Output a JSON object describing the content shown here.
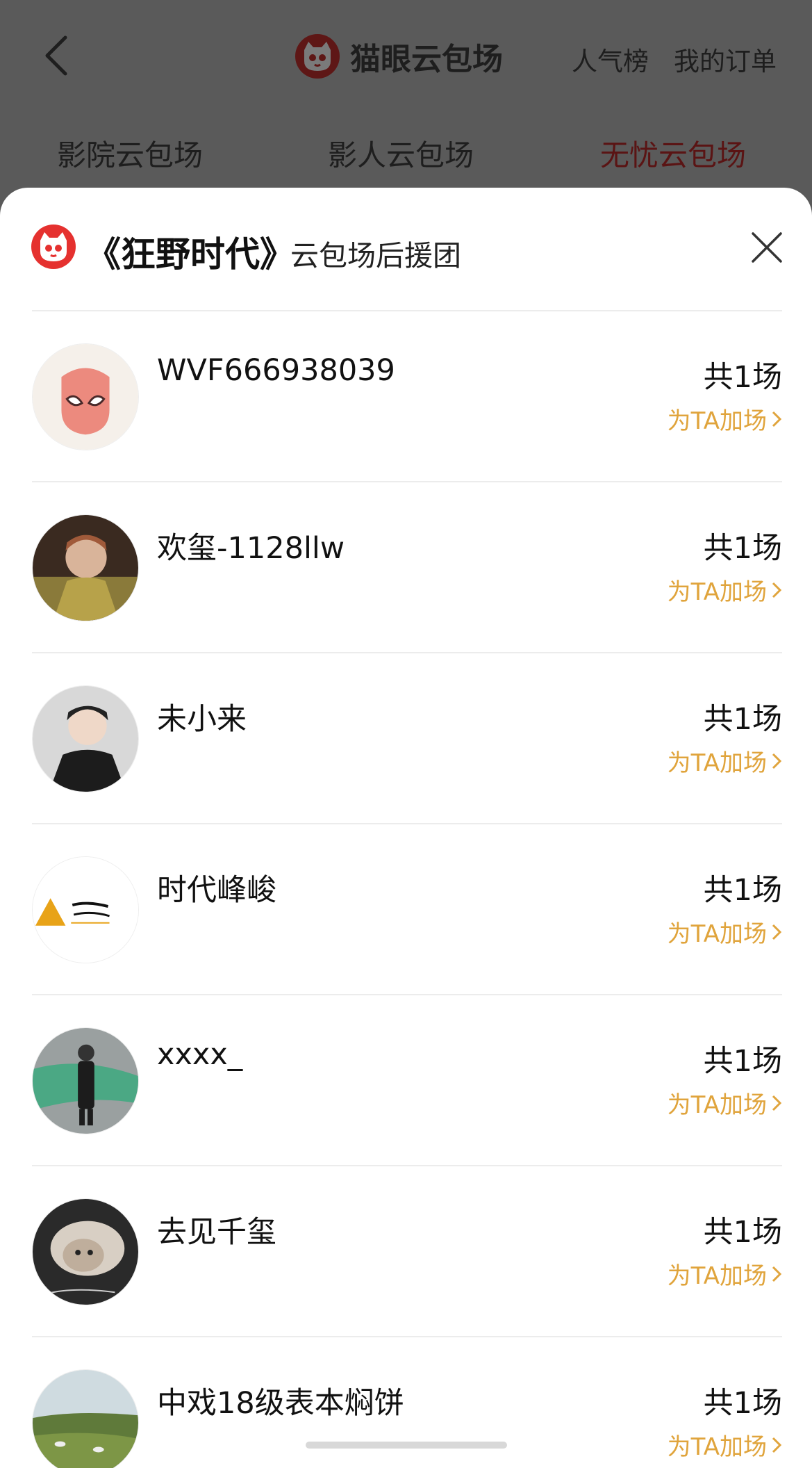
{
  "top_bar": {
    "back_icon": "chevron-left-icon",
    "brand_title": "猫眼云包场",
    "links": [
      "人气榜",
      "我的订单"
    ]
  },
  "tabs": [
    {
      "label": "影院云包场"
    },
    {
      "label": "影人云包场"
    },
    {
      "label": "无忧云包场"
    }
  ],
  "sheet": {
    "title": "《狂野时代》",
    "subtitle": "云包场后援团",
    "close_icon": "close-icon"
  },
  "supporters": [
    {
      "name": "WVF666938039",
      "count": "共1场",
      "action": "为TA加场"
    },
    {
      "name": "欢玺-1128llw",
      "count": "共1场",
      "action": "为TA加场"
    },
    {
      "name": "未小来",
      "count": "共1场",
      "action": "为TA加场"
    },
    {
      "name": "时代峰峻",
      "count": "共1场",
      "action": "为TA加场"
    },
    {
      "name": "xxxx_",
      "count": "共1场",
      "action": "为TA加场"
    },
    {
      "name": "去见千玺",
      "count": "共1场",
      "action": "为TA加场"
    },
    {
      "name": "中戏18级表本焖饼",
      "count": "共1场",
      "action": "为TA加场"
    }
  ],
  "colors": {
    "brand_red": "#e5312f",
    "action_orange": "#e0a43c",
    "overlay_gray": "#5a5a5a",
    "active_tab_dim": "#5a1414"
  }
}
